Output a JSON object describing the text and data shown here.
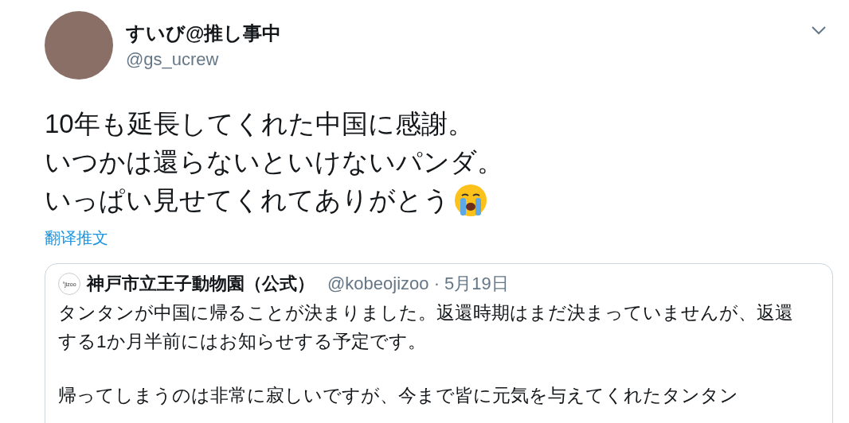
{
  "tweet": {
    "author": {
      "name": "すいび@推し事中",
      "handle": "@gs_ucrew"
    },
    "text_lines": [
      "10年も延長してくれた中国に感謝。",
      "いつかは還らないといけないパンダ。",
      "いっぱい見せてくれてありがとう"
    ],
    "translate_link": "翻译推文",
    "quoted_tweet": {
      "logo_text": "°jizoo",
      "name": "神戸市立王子動物園（公式）",
      "handle": "@kobeojizoo",
      "separator": "·",
      "date": "5月19日",
      "paragraphs": [
        "タンタンが中国に帰ることが決まりました。返還時期はまだ決まっていませんが、返還する1か月半前にはお知らせする予定です。",
        "帰ってしまうのは非常に寂しいですが、今まで皆に元気を与えてくれたタンタン"
      ]
    }
  }
}
